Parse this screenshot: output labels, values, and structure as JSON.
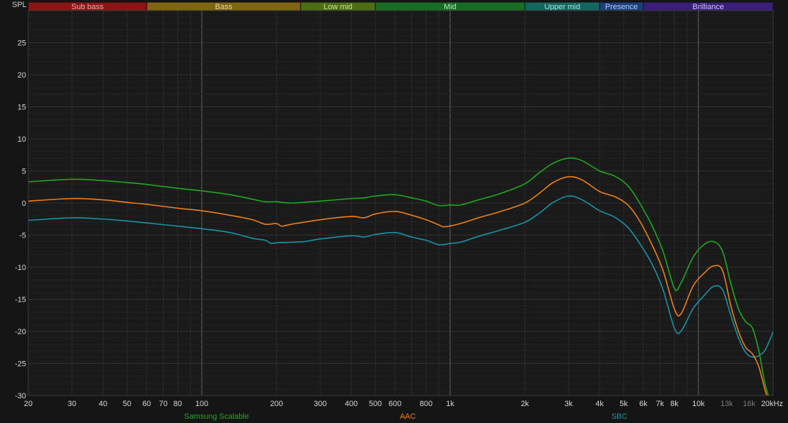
{
  "chart_data": {
    "type": "line",
    "ylabel": "SPL",
    "x_scale": "log",
    "xlim": [
      20,
      20000
    ],
    "ylim": [
      -30,
      30
    ],
    "grid": true,
    "legend_position": "bottom",
    "bands": [
      {
        "label": "Sub bass",
        "from": 20,
        "to": 60,
        "color": "#8b1414",
        "text_color": "#e6b0b0"
      },
      {
        "label": "Bass",
        "from": 60,
        "to": 250,
        "color": "#806614",
        "text_color": "#e6d8a8"
      },
      {
        "label": "Low mid",
        "from": 250,
        "to": 500,
        "color": "#4d6e14",
        "text_color": "#c8e0a0"
      },
      {
        "label": "Mid",
        "from": 500,
        "to": 2000,
        "color": "#1a6b24",
        "text_color": "#b8e8c0"
      },
      {
        "label": "Upper mid",
        "from": 2000,
        "to": 4000,
        "color": "#166660",
        "text_color": "#b0e0dc"
      },
      {
        "label": "Presence",
        "from": 4000,
        "to": 6000,
        "color": "#1b3f7a",
        "text_color": "#b8cbef"
      },
      {
        "label": "Brilliance",
        "from": 6000,
        "to": 20000,
        "color": "#3a1f78",
        "text_color": "#d0c4f0"
      }
    ],
    "x_ticks": [
      {
        "v": 20,
        "label": "20"
      },
      {
        "v": 30,
        "label": "30"
      },
      {
        "v": 40,
        "label": "40"
      },
      {
        "v": 50,
        "label": "50"
      },
      {
        "v": 60,
        "label": "60"
      },
      {
        "v": 70,
        "label": "70"
      },
      {
        "v": 80,
        "label": "80"
      },
      {
        "v": 100,
        "label": "100"
      },
      {
        "v": 200,
        "label": "200"
      },
      {
        "v": 300,
        "label": "300"
      },
      {
        "v": 400,
        "label": "400"
      },
      {
        "v": 500,
        "label": "500"
      },
      {
        "v": 600,
        "label": "600"
      },
      {
        "v": 800,
        "label": "800"
      },
      {
        "v": 1000,
        "label": "1k"
      },
      {
        "v": 2000,
        "label": "2k"
      },
      {
        "v": 3000,
        "label": "3k"
      },
      {
        "v": 4000,
        "label": "4k"
      },
      {
        "v": 5000,
        "label": "5k"
      },
      {
        "v": 6000,
        "label": "6k"
      },
      {
        "v": 7000,
        "label": "7k"
      },
      {
        "v": 8000,
        "label": "8k"
      },
      {
        "v": 10000,
        "label": "10k"
      },
      {
        "v": 13000,
        "label": "13k",
        "dim": true
      },
      {
        "v": 16000,
        "label": "16k",
        "dim": true
      },
      {
        "v": 20000,
        "label": "20kHz"
      }
    ],
    "y_ticks": [
      25,
      20,
      15,
      10,
      5,
      0,
      -5,
      -10,
      -15,
      -20,
      -25,
      -30
    ],
    "series": [
      {
        "name": "Samsung Scalable",
        "color": "#1faa1f",
        "points": [
          [
            20,
            3.3
          ],
          [
            30,
            3.7
          ],
          [
            40,
            3.5
          ],
          [
            50,
            3.2
          ],
          [
            60,
            2.9
          ],
          [
            80,
            2.3
          ],
          [
            100,
            1.9
          ],
          [
            130,
            1.3
          ],
          [
            160,
            0.6
          ],
          [
            180,
            0.2
          ],
          [
            200,
            0.2
          ],
          [
            230,
            0.0
          ],
          [
            300,
            0.3
          ],
          [
            400,
            0.7
          ],
          [
            450,
            0.8
          ],
          [
            500,
            1.1
          ],
          [
            600,
            1.3
          ],
          [
            700,
            0.8
          ],
          [
            800,
            0.3
          ],
          [
            900,
            -0.4
          ],
          [
            1000,
            -0.3
          ],
          [
            1100,
            -0.3
          ],
          [
            1300,
            0.5
          ],
          [
            1600,
            1.5
          ],
          [
            2000,
            3.0
          ],
          [
            2300,
            4.8
          ],
          [
            2600,
            6.2
          ],
          [
            3000,
            7.0
          ],
          [
            3400,
            6.6
          ],
          [
            4000,
            5.0
          ],
          [
            4600,
            4.2
          ],
          [
            5200,
            2.7
          ],
          [
            5800,
            0.0
          ],
          [
            6500,
            -3.5
          ],
          [
            7200,
            -7.5
          ],
          [
            8000,
            -13.3
          ],
          [
            8500,
            -12.5
          ],
          [
            9500,
            -8.5
          ],
          [
            10500,
            -6.5
          ],
          [
            11500,
            -6.0
          ],
          [
            12500,
            -7.5
          ],
          [
            13500,
            -12.5
          ],
          [
            14500,
            -16.5
          ],
          [
            15500,
            -18.5
          ],
          [
            16500,
            -19.5
          ],
          [
            17500,
            -23.0
          ],
          [
            18500,
            -28.0
          ],
          [
            19300,
            -30.5
          ]
        ]
      },
      {
        "name": "AAC",
        "color": "#f07f1a",
        "points": [
          [
            20,
            0.3
          ],
          [
            30,
            0.7
          ],
          [
            40,
            0.5
          ],
          [
            50,
            0.1
          ],
          [
            60,
            -0.2
          ],
          [
            80,
            -0.8
          ],
          [
            100,
            -1.2
          ],
          [
            130,
            -1.9
          ],
          [
            160,
            -2.6
          ],
          [
            180,
            -3.3
          ],
          [
            200,
            -3.2
          ],
          [
            210,
            -3.6
          ],
          [
            230,
            -3.3
          ],
          [
            300,
            -2.6
          ],
          [
            400,
            -2.1
          ],
          [
            450,
            -2.3
          ],
          [
            500,
            -1.7
          ],
          [
            600,
            -1.3
          ],
          [
            700,
            -1.9
          ],
          [
            800,
            -2.6
          ],
          [
            900,
            -3.4
          ],
          [
            950,
            -3.7
          ],
          [
            1100,
            -3.2
          ],
          [
            1300,
            -2.3
          ],
          [
            1600,
            -1.3
          ],
          [
            2000,
            0.0
          ],
          [
            2300,
            1.6
          ],
          [
            2600,
            3.2
          ],
          [
            3000,
            4.1
          ],
          [
            3400,
            3.6
          ],
          [
            4000,
            1.8
          ],
          [
            4600,
            1.0
          ],
          [
            5200,
            -0.3
          ],
          [
            5800,
            -2.8
          ],
          [
            6500,
            -6.5
          ],
          [
            7200,
            -10.5
          ],
          [
            8000,
            -16.5
          ],
          [
            8500,
            -17.3
          ],
          [
            9500,
            -13.0
          ],
          [
            10500,
            -11.0
          ],
          [
            11500,
            -9.8
          ],
          [
            12500,
            -10.5
          ],
          [
            13500,
            -16.0
          ],
          [
            14500,
            -20.0
          ],
          [
            15500,
            -22.5
          ],
          [
            16500,
            -23.5
          ],
          [
            17500,
            -25.5
          ],
          [
            18500,
            -29.0
          ],
          [
            19000,
            -30.5
          ]
        ]
      },
      {
        "name": "SBC",
        "color": "#1a93a6",
        "points": [
          [
            20,
            -2.7
          ],
          [
            30,
            -2.3
          ],
          [
            40,
            -2.5
          ],
          [
            50,
            -2.8
          ],
          [
            60,
            -3.1
          ],
          [
            80,
            -3.6
          ],
          [
            100,
            -4.0
          ],
          [
            130,
            -4.6
          ],
          [
            160,
            -5.5
          ],
          [
            180,
            -5.8
          ],
          [
            190,
            -6.3
          ],
          [
            200,
            -6.2
          ],
          [
            230,
            -6.1
          ],
          [
            260,
            -6.0
          ],
          [
            300,
            -5.6
          ],
          [
            400,
            -5.1
          ],
          [
            450,
            -5.3
          ],
          [
            500,
            -4.9
          ],
          [
            600,
            -4.6
          ],
          [
            700,
            -5.3
          ],
          [
            800,
            -5.8
          ],
          [
            900,
            -6.5
          ],
          [
            1000,
            -6.3
          ],
          [
            1100,
            -6.1
          ],
          [
            1300,
            -5.2
          ],
          [
            1600,
            -4.2
          ],
          [
            2000,
            -3.0
          ],
          [
            2300,
            -1.5
          ],
          [
            2600,
            0.1
          ],
          [
            3000,
            1.1
          ],
          [
            3400,
            0.5
          ],
          [
            4000,
            -1.2
          ],
          [
            4600,
            -2.2
          ],
          [
            5200,
            -3.8
          ],
          [
            5800,
            -6.3
          ],
          [
            6500,
            -9.5
          ],
          [
            7200,
            -13.5
          ],
          [
            8000,
            -19.5
          ],
          [
            8500,
            -20.0
          ],
          [
            9500,
            -16.5
          ],
          [
            10500,
            -14.5
          ],
          [
            11500,
            -13.0
          ],
          [
            12500,
            -13.5
          ],
          [
            13500,
            -17.5
          ],
          [
            14500,
            -21.0
          ],
          [
            15500,
            -23.3
          ],
          [
            16500,
            -24.0
          ],
          [
            17500,
            -23.8
          ],
          [
            18500,
            -23.0
          ],
          [
            19300,
            -21.5
          ],
          [
            20000,
            -20.0
          ]
        ]
      }
    ]
  }
}
